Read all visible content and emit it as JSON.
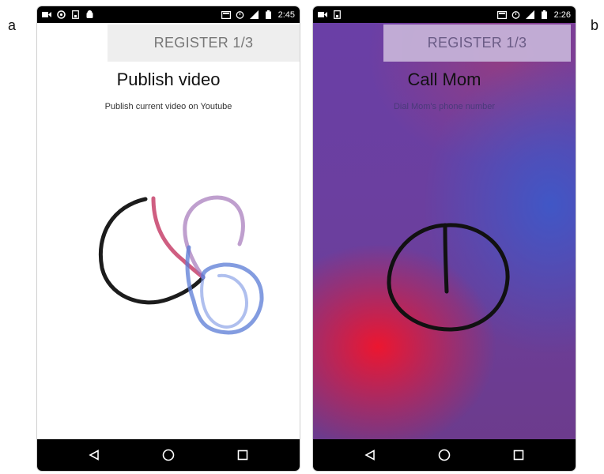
{
  "figure": {
    "label_a": "a",
    "label_b": "b"
  },
  "phones": [
    {
      "status": {
        "time": "2:45"
      },
      "register_label": "REGISTER 1/3",
      "title": "Publish video",
      "subtitle": "Publish current video on Youtube",
      "background": "#ffffff",
      "register_bg": "#eeeeee",
      "register_color": "#777777"
    },
    {
      "status": {
        "time": "2:26"
      },
      "register_label": "REGISTER 1/3",
      "title": "Call Mom",
      "subtitle": "Dial Mom's phone number",
      "background": "gradient-red-blue-purple",
      "register_bg": "#c5b1d8",
      "register_color": "#6a5e86"
    }
  ],
  "colors": {
    "statusbar": "#000000",
    "navbar": "#000000",
    "stroke_black": "#1a1a1a",
    "stroke_red": "#c8406a",
    "stroke_purple": "#a070b8",
    "stroke_blue": "#5a7ad8"
  },
  "icons": {
    "nav": [
      "back-triangle-icon",
      "home-circle-icon",
      "recents-square-icon"
    ],
    "status_left_a": [
      "video-icon",
      "whatsapp-icon",
      "sd-card-icon",
      "android-icon"
    ],
    "status_left_b": [
      "video-icon",
      "sd-card-icon"
    ],
    "status_right": [
      "cast-icon",
      "alarm-icon",
      "signal-icon",
      "battery-icon"
    ]
  }
}
